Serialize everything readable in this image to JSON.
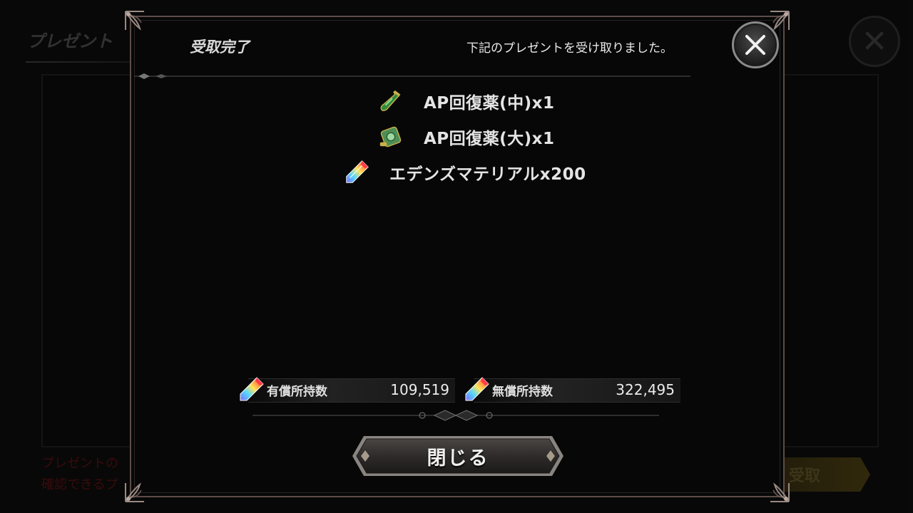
{
  "background": {
    "title": "プレゼント",
    "notice_line1": "プレゼントの",
    "notice_line2": "確認できるプ",
    "receive_button_label": "受取"
  },
  "modal": {
    "title": "受取完了",
    "message": "下記のプレゼントを受け取りました。",
    "items": [
      {
        "label": "AP回復薬(中)x1",
        "icon": "green-potion-bottle-icon"
      },
      {
        "label": "AP回復薬(大)x1",
        "icon": "green-potion-jar-icon"
      },
      {
        "label": "エデンズマテリアルx200",
        "icon": "rainbow-crystal-icon"
      }
    ],
    "balances": [
      {
        "label": "有償所持数",
        "value": "109,519",
        "icon": "rainbow-crystal-icon"
      },
      {
        "label": "無償所持数",
        "value": "322,495",
        "icon": "rainbow-crystal-icon"
      }
    ],
    "close_button_label": "閉じる"
  },
  "colors": {
    "modal_border": "#5e4c48",
    "notice_text": "#6a1414",
    "gold_button": "#5a4b18"
  }
}
